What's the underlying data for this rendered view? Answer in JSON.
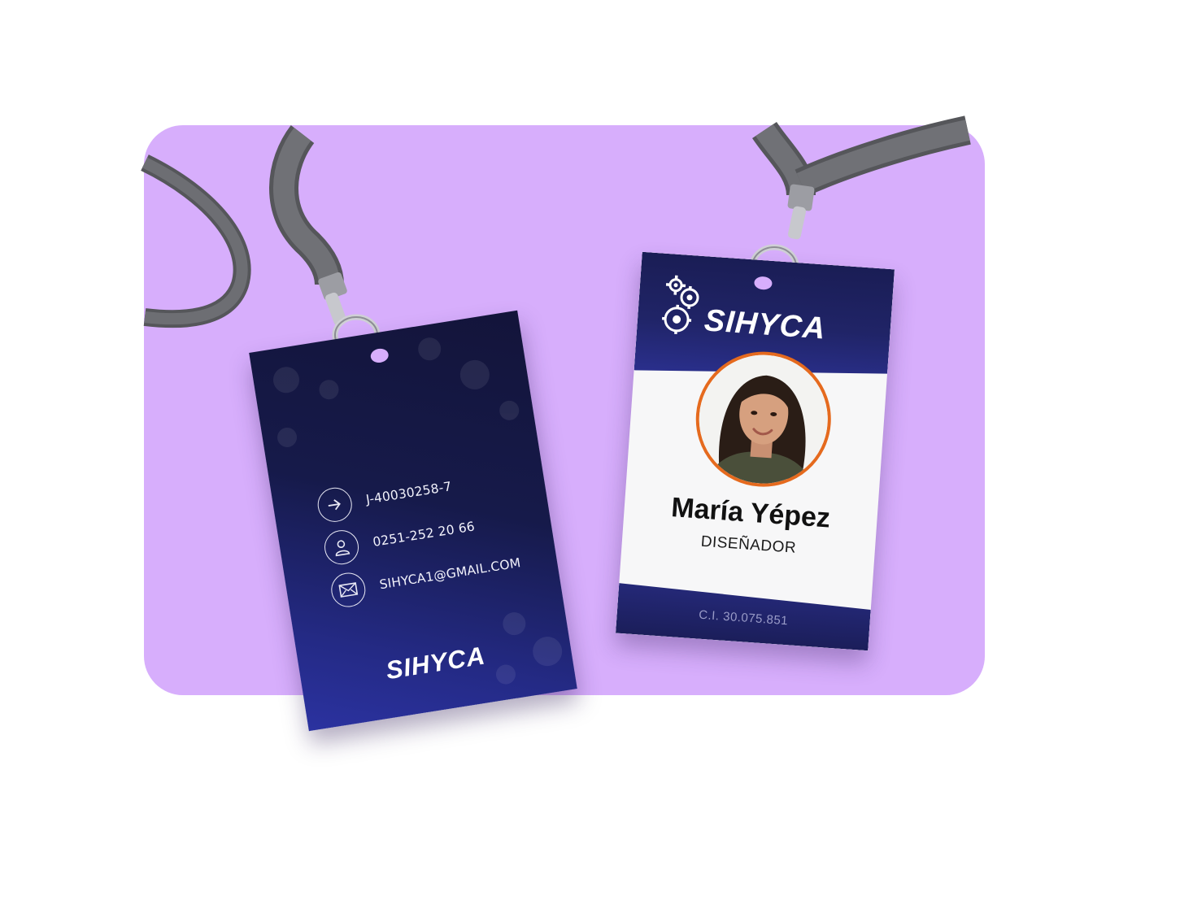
{
  "scene": {
    "background_color": "#ffffff",
    "panel_color": "#d7aefc"
  },
  "back_card": {
    "contacts": [
      {
        "icon": "arrow-right-icon",
        "text": "J-40030258-7"
      },
      {
        "icon": "user-icon",
        "text": "0251-252 20 66"
      },
      {
        "icon": "mail-icon",
        "text": "SIHYCA1@GMAIL.COM"
      }
    ],
    "logo_text": "SIHYCA",
    "colors": {
      "top": "#13143a",
      "bottom": "#2b32a0"
    }
  },
  "front_card": {
    "logo_text": "SIHYCA",
    "name": "María Yépez",
    "role": "DISEÑADOR",
    "id_number": "C.I. 30.075.851",
    "colors": {
      "header": "#1a1d55",
      "photo_border": "#e56a1e"
    }
  }
}
